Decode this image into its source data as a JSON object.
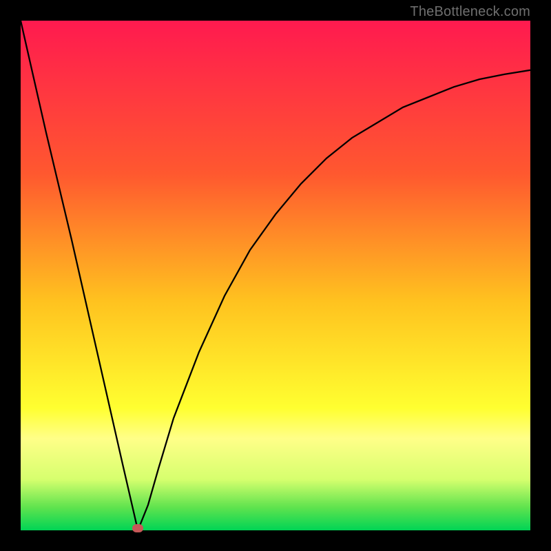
{
  "watermark": "TheBottleneck.com",
  "colors": {
    "bg_black": "#000000",
    "grad_top": "#ff1a4f",
    "grad_mid1": "#ff7b2a",
    "grad_mid2": "#ffd21f",
    "grad_band": "#ffff63",
    "grad_bottom_band": "#5fe34e",
    "grad_bottom": "#00d455",
    "curve": "#000000",
    "marker": "#c75858"
  },
  "chart_data": {
    "type": "line",
    "title": "",
    "xlabel": "",
    "ylabel": "",
    "xlim": [
      0,
      100
    ],
    "ylim": [
      0,
      100
    ],
    "series": [
      {
        "name": "bottleneck-curve",
        "x": [
          0,
          5,
          10,
          15,
          20,
          23,
          25,
          27,
          30,
          35,
          40,
          45,
          50,
          55,
          60,
          65,
          70,
          75,
          80,
          85,
          90,
          95,
          100
        ],
        "values": [
          100,
          78,
          57,
          35,
          13,
          0,
          5,
          12,
          22,
          35,
          46,
          55,
          62,
          68,
          73,
          77,
          80,
          83,
          85,
          87,
          88.5,
          89.5,
          90.3
        ]
      }
    ],
    "markers": [
      {
        "name": "minimum-point",
        "x": 23,
        "y": 0
      }
    ],
    "gradient_stops": [
      {
        "pos": 0.0,
        "color": "#ff1a4f"
      },
      {
        "pos": 0.3,
        "color": "#ff582f"
      },
      {
        "pos": 0.55,
        "color": "#ffc21f"
      },
      {
        "pos": 0.76,
        "color": "#ffff30"
      },
      {
        "pos": 0.82,
        "color": "#ffff88"
      },
      {
        "pos": 0.9,
        "color": "#d6ff6e"
      },
      {
        "pos": 0.955,
        "color": "#5fe34e"
      },
      {
        "pos": 1.0,
        "color": "#00d455"
      }
    ]
  }
}
